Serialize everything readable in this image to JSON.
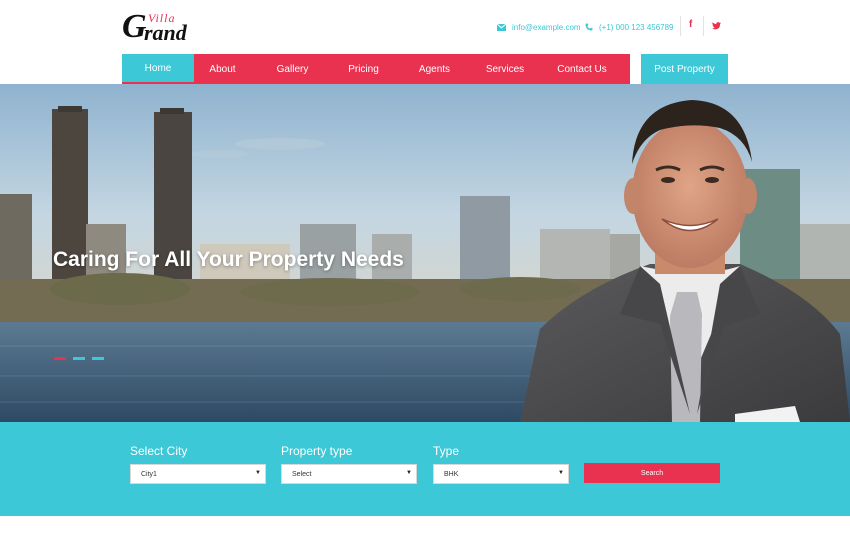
{
  "brand": {
    "logo_g": "G",
    "logo_villa": "Villa",
    "logo_rand": "rand"
  },
  "header": {
    "email": "info@example.com",
    "phone": "(+1) 000 123 456789",
    "social": [
      "f",
      "♥"
    ]
  },
  "nav": {
    "items": [
      "Home",
      "About",
      "Gallery",
      "Pricing",
      "Agents",
      "Services",
      "Contact Us"
    ],
    "active": "Home",
    "post_property": "Post Property"
  },
  "hero": {
    "heading": "Caring For All Your Property Needs",
    "slides": 3,
    "active_slide": 1
  },
  "search": {
    "city_label": "Select City",
    "city_value": "City1",
    "type_label": "Property type",
    "type_value": "Select",
    "bhk_label": "Type",
    "bhk_value": "BHK",
    "button": "Search"
  },
  "colors": {
    "accent_pink": "#e83250",
    "accent_teal": "#3cc8d6"
  },
  "icons": [
    "envelope-icon",
    "phone-icon",
    "facebook-icon",
    "twitter-icon",
    "caret-down-icon"
  ]
}
